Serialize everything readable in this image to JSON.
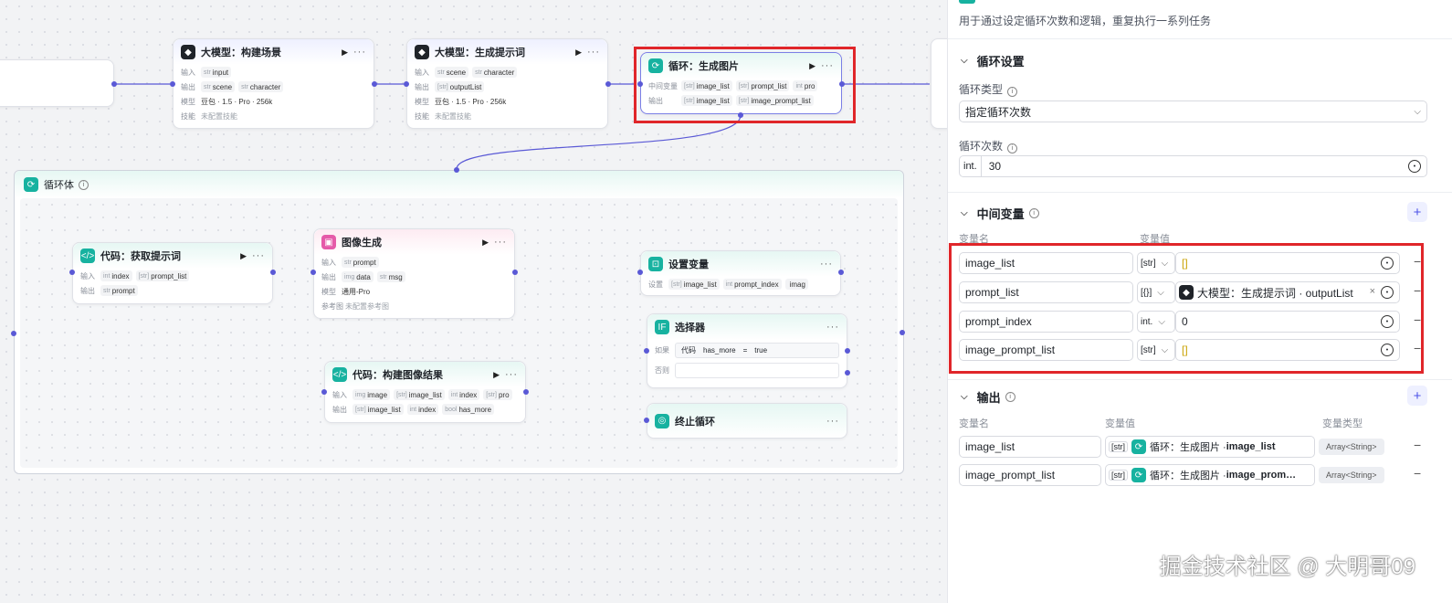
{
  "canvas": {
    "node_llm_scene": {
      "title": "大模型：构建场景",
      "in_label": "输入",
      "in_vars": [
        {
          "type": "str",
          "name": "input"
        }
      ],
      "out_label": "输出",
      "out_vars": [
        {
          "type": "str",
          "name": "scene"
        },
        {
          "type": "str",
          "name": "character"
        }
      ],
      "model_label": "模型",
      "model_value": "豆包 · 1.5 · Pro · 256k",
      "skill_label": "技能",
      "skill_value": "未配置技能"
    },
    "node_llm_prompt": {
      "title": "大模型：生成提示词",
      "in_label": "输入",
      "in_vars": [
        {
          "type": "str",
          "name": "scene"
        },
        {
          "type": "str",
          "name": "character"
        }
      ],
      "out_label": "输出",
      "out_vars": [
        {
          "type": "[str]",
          "name": "outputList"
        }
      ],
      "model_label": "模型",
      "model_value": "豆包 · 1.5 · Pro · 256k",
      "skill_label": "技能",
      "skill_value": "未配置技能"
    },
    "node_loop": {
      "title": "循环：生成图片",
      "mid_label": "中间变量",
      "mid_vars": [
        {
          "type": "[str]",
          "name": "image_list"
        },
        {
          "type": "[str]",
          "name": "prompt_list"
        },
        {
          "type": "int",
          "name": "pro"
        }
      ],
      "out_label": "输出",
      "out_vars": [
        {
          "type": "[str]",
          "name": "image_list"
        },
        {
          "type": "[str]",
          "name": "image_prompt_list"
        }
      ]
    },
    "loop_body": {
      "title": "循环体"
    },
    "node_code_get": {
      "title": "代码：获取提示词",
      "in_label": "输入",
      "in_vars": [
        {
          "type": "int",
          "name": "index"
        },
        {
          "type": "[str]",
          "name": "prompt_list"
        }
      ],
      "out_label": "输出",
      "out_vars": [
        {
          "type": "str",
          "name": "prompt"
        }
      ]
    },
    "node_image": {
      "title": "图像生成",
      "in_label": "输入",
      "in_vars": [
        {
          "type": "str",
          "name": "prompt"
        }
      ],
      "out_label": "输出",
      "out_vars": [
        {
          "type": "img",
          "name": "data"
        },
        {
          "type": "str",
          "name": "msg"
        }
      ],
      "model_label": "模型",
      "model_value": "通用-Pro",
      "ref_label": "参考图",
      "ref_value": "未配置参考图"
    },
    "node_set_var": {
      "title": "设置变量",
      "label": "设置",
      "vars": [
        {
          "type": "[str]",
          "name": "image_list"
        },
        {
          "type": "int",
          "name": "prompt_index"
        },
        {
          "type": "",
          "name": "imag"
        }
      ]
    },
    "node_selector": {
      "title": "选择器",
      "if_label": "如果",
      "cond_src": "代码",
      "cond_var": "has_more",
      "cond_op": "=",
      "cond_val": "true",
      "else_label": "否则"
    },
    "node_code_build": {
      "title": "代码：构建图像结果",
      "in_label": "输入",
      "in_vars": [
        {
          "type": "img",
          "name": "image"
        },
        {
          "type": "[str]",
          "name": "image_list"
        },
        {
          "type": "int",
          "name": "index"
        },
        {
          "type": "[str]",
          "name": "pro"
        }
      ],
      "out_label": "输出",
      "out_vars": [
        {
          "type": "[str]",
          "name": "image_list"
        },
        {
          "type": "int",
          "name": "index"
        },
        {
          "type": "bool",
          "name": "has_more"
        }
      ]
    },
    "node_break": {
      "title": "终止循环"
    }
  },
  "panel": {
    "description": "用于通过设定循环次数和逻辑，重复执行一系列任务",
    "loop_settings": {
      "title": "循环设置",
      "type_label": "循环类型",
      "type_value": "指定循环次数",
      "count_label": "循环次数",
      "count_type": "int.",
      "count_value": "30"
    },
    "mid_vars": {
      "title": "中间变量",
      "col_name": "变量名",
      "col_value": "变量值",
      "rows": [
        {
          "name": "image_list",
          "type": "[str]",
          "value": "[]",
          "value_kind": "literal"
        },
        {
          "name": "prompt_list",
          "type": "[{}]",
          "value": "大模型：生成提示词 · outputList",
          "value_kind": "ref"
        },
        {
          "name": "prompt_index",
          "type": "int.",
          "value": "0",
          "value_kind": "literal"
        },
        {
          "name": "image_prompt_list",
          "type": "[str]",
          "value": "[]",
          "value_kind": "literal"
        }
      ]
    },
    "output": {
      "title": "输出",
      "col_name": "变量名",
      "col_value": "变量值",
      "col_type": "变量类型",
      "rows": [
        {
          "name": "image_list",
          "type": "[str]",
          "value_prefix": "循环：生成图片 · ",
          "value_main": "image_list",
          "var_type": "Array<String>"
        },
        {
          "name": "image_prompt_list",
          "type": "[str]",
          "value_prefix": "循环：生成图片 · ",
          "value_main": "image_prom…",
          "var_type": "Array<String>"
        }
      ]
    }
  },
  "watermark": "掘金技术社区 @ 大明哥09",
  "colors": {
    "accent": "#4d53e8",
    "edge": "#5a59d6",
    "highlight": "#e0262a",
    "loop_teal": "#17b2a0",
    "ref_yellow": "#c9a100"
  }
}
